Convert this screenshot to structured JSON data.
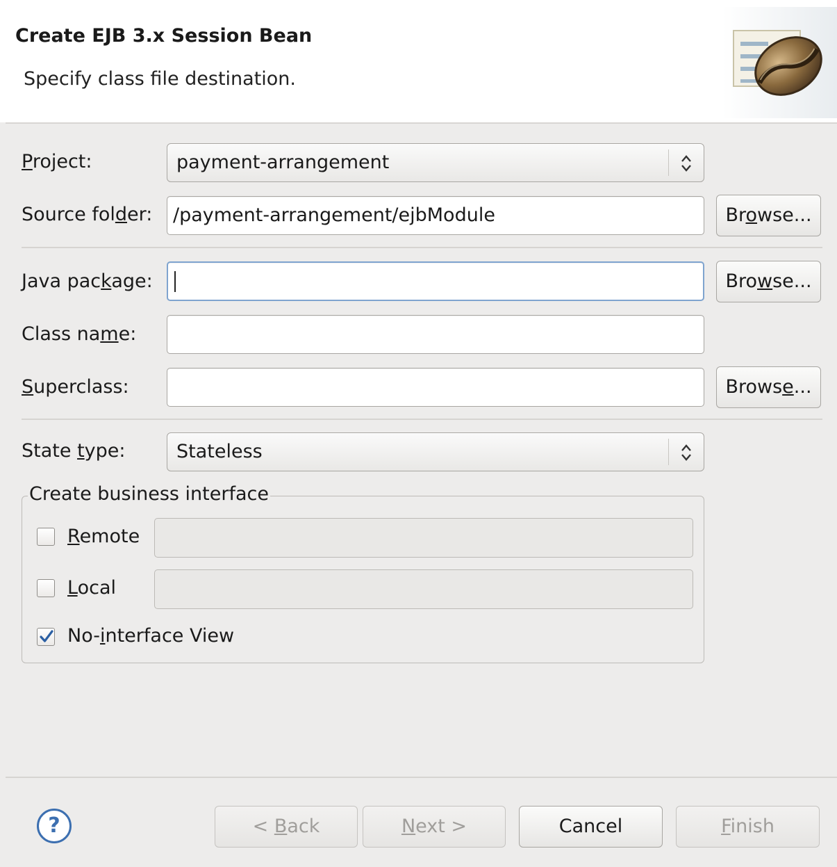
{
  "header": {
    "title": "Create EJB 3.x Session Bean",
    "subtitle": "Specify class file destination.",
    "image_icon": "coffee-bean-wizard-icon"
  },
  "form": {
    "project": {
      "label_pre": "",
      "label_mn": "P",
      "label_post": "roject:",
      "value": "payment-arrangement"
    },
    "source_folder": {
      "label_pre": "Source fol",
      "label_mn": "d",
      "label_post": "er:",
      "value": "/payment-arrangement/ejbModule",
      "browse": {
        "pre": "Br",
        "mn": "o",
        "post": "wse..."
      }
    },
    "java_package": {
      "label_pre": "Java pac",
      "label_mn": "k",
      "label_post": "age:",
      "value": "",
      "browse": {
        "pre": "Bro",
        "mn": "w",
        "post": "se..."
      }
    },
    "class_name": {
      "label_pre": "Class na",
      "label_mn": "m",
      "label_post": "e:",
      "value": ""
    },
    "superclass": {
      "label_pre": "",
      "label_mn": "S",
      "label_post": "uperclass:",
      "value": "",
      "browse": {
        "pre": "Brows",
        "mn": "e",
        "post": "..."
      }
    },
    "state_type": {
      "label_pre": "State ",
      "label_mn": "t",
      "label_post": "ype:",
      "value": "Stateless"
    }
  },
  "business_interface": {
    "group_label": "Create business interface",
    "remote": {
      "pre": "",
      "mn": "R",
      "post": "emote",
      "checked": false,
      "value": ""
    },
    "local": {
      "pre": "",
      "mn": "L",
      "post": "ocal",
      "checked": false,
      "value": ""
    },
    "no_interface": {
      "pre": "No-",
      "mn": "i",
      "post": "nterface View",
      "checked": true
    }
  },
  "footer": {
    "help_glyph": "?",
    "back": {
      "pre": "< ",
      "mn": "B",
      "post": "ack"
    },
    "next": {
      "pre": "",
      "mn": "N",
      "post": "ext >"
    },
    "cancel": "Cancel",
    "finish": {
      "pre": "",
      "mn": "F",
      "post": "inish"
    }
  }
}
